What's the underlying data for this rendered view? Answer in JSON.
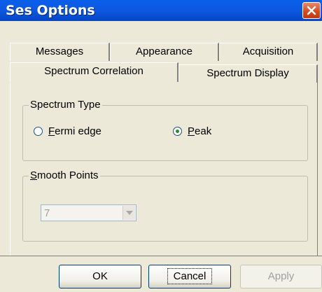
{
  "window": {
    "title": "Ses Options"
  },
  "tabs": {
    "back_row": [
      "Messages",
      "Appearance",
      "Acquisition"
    ],
    "front_row": [
      "Spectrum Correlation",
      "Spectrum Display"
    ],
    "active": "Spectrum Correlation"
  },
  "spectrum_type": {
    "legend": "Spectrum Type",
    "options": [
      {
        "label_prefix": "",
        "label_mnemonic": "F",
        "label_rest": "ermi edge",
        "checked": false
      },
      {
        "label_prefix": "",
        "label_mnemonic": "P",
        "label_rest": "eak",
        "checked": true
      }
    ]
  },
  "smooth_points": {
    "legend_mnemonic": "S",
    "legend_rest": "mooth Points",
    "value": "7",
    "disabled": true
  },
  "buttons": {
    "ok": "OK",
    "cancel": "Cancel",
    "apply": "Apply"
  }
}
